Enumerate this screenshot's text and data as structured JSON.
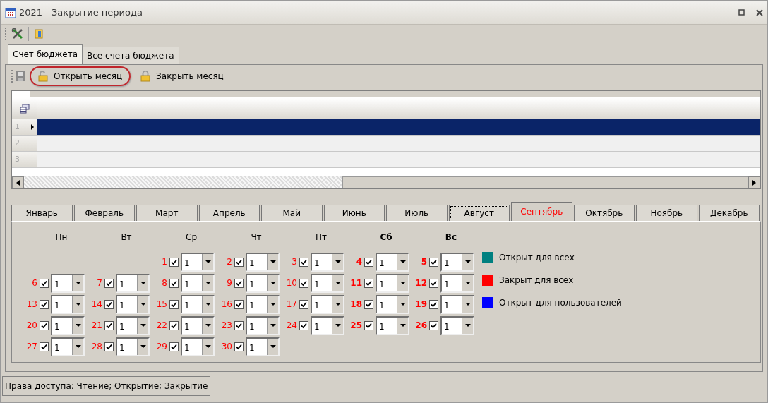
{
  "window": {
    "title": "2021 - Закрытие периода"
  },
  "tabs": [
    {
      "label": "Счет бюджета",
      "selected": true
    },
    {
      "label": "Все счета бюджета",
      "selected": false
    }
  ],
  "toolbar": [
    {
      "kind": "open",
      "label": "Открыть месяц",
      "highlighted": true
    },
    {
      "kind": "close",
      "label": "Закрыть месяц",
      "highlighted": false
    }
  ],
  "grid": {
    "rows": [
      {
        "number": "1",
        "selected": true
      },
      {
        "number": "2",
        "selected": false
      },
      {
        "number": "3",
        "selected": false
      }
    ]
  },
  "months": [
    {
      "label": "Январь",
      "selected": false,
      "focused": false
    },
    {
      "label": "Февраль",
      "selected": false,
      "focused": false
    },
    {
      "label": "Март",
      "selected": false,
      "focused": false
    },
    {
      "label": "Апрель",
      "selected": false,
      "focused": false
    },
    {
      "label": "Май",
      "selected": false,
      "focused": false
    },
    {
      "label": "Июнь",
      "selected": false,
      "focused": false
    },
    {
      "label": "Июль",
      "selected": false,
      "focused": false
    },
    {
      "label": "Август",
      "selected": false,
      "focused": true
    },
    {
      "label": "Сентябрь",
      "selected": true,
      "focused": false
    },
    {
      "label": "Октябрь",
      "selected": false,
      "focused": false
    },
    {
      "label": "Ноябрь",
      "selected": false,
      "focused": false
    },
    {
      "label": "Декабрь",
      "selected": false,
      "focused": false
    }
  ],
  "weekdays": [
    {
      "label": "Пн",
      "weekend": false
    },
    {
      "label": "Вт",
      "weekend": false
    },
    {
      "label": "Ср",
      "weekend": false
    },
    {
      "label": "Чт",
      "weekend": false
    },
    {
      "label": "Пт",
      "weekend": false
    },
    {
      "label": "Сб",
      "weekend": true
    },
    {
      "label": "Вс",
      "weekend": true
    }
  ],
  "weeks": [
    [
      {
        "kind": "blank"
      },
      {
        "kind": "blank"
      },
      {
        "day": "1",
        "checked": true,
        "value": "1"
      },
      {
        "day": "2",
        "checked": true,
        "value": "1"
      },
      {
        "day": "3",
        "checked": true,
        "value": "1"
      },
      {
        "day": "4",
        "checked": true,
        "value": "1"
      },
      {
        "day": "5",
        "checked": true,
        "value": "1"
      }
    ],
    [
      {
        "day": "6",
        "checked": true,
        "value": "1"
      },
      {
        "day": "7",
        "checked": true,
        "value": "1"
      },
      {
        "day": "8",
        "checked": true,
        "value": "1"
      },
      {
        "day": "9",
        "checked": true,
        "value": "1"
      },
      {
        "day": "10",
        "checked": true,
        "value": "1"
      },
      {
        "day": "11",
        "checked": true,
        "value": "1"
      },
      {
        "day": "12",
        "checked": true,
        "value": "1"
      }
    ],
    [
      {
        "day": "13",
        "checked": true,
        "value": "1"
      },
      {
        "day": "14",
        "checked": true,
        "value": "1"
      },
      {
        "day": "15",
        "checked": true,
        "value": "1"
      },
      {
        "day": "16",
        "checked": true,
        "value": "1"
      },
      {
        "day": "17",
        "checked": true,
        "value": "1"
      },
      {
        "day": "18",
        "checked": true,
        "value": "1"
      },
      {
        "day": "19",
        "checked": true,
        "value": "1"
      }
    ],
    [
      {
        "day": "20",
        "checked": true,
        "value": "1"
      },
      {
        "day": "21",
        "checked": true,
        "value": "1"
      },
      {
        "day": "22",
        "checked": true,
        "value": "1"
      },
      {
        "day": "23",
        "checked": true,
        "value": "1"
      },
      {
        "day": "24",
        "checked": true,
        "value": "1"
      },
      {
        "day": "25",
        "checked": true,
        "value": "1"
      },
      {
        "day": "26",
        "checked": true,
        "value": "1"
      }
    ],
    [
      {
        "day": "27",
        "checked": true,
        "value": "1"
      },
      {
        "day": "28",
        "checked": true,
        "value": "1"
      },
      {
        "day": "29",
        "checked": true,
        "value": "1"
      },
      {
        "day": "30",
        "checked": true,
        "value": "1"
      }
    ]
  ],
  "legend": [
    {
      "label": "Открыт для всех",
      "color": "#008080"
    },
    {
      "label": "Закрыт для всех",
      "color": "#ff0000"
    },
    {
      "label": "Открыт для пользователей",
      "color": "#0000ff"
    }
  ],
  "status_bar": {
    "text": "Права доступа: Чтение; Открытие; Закрытие"
  }
}
